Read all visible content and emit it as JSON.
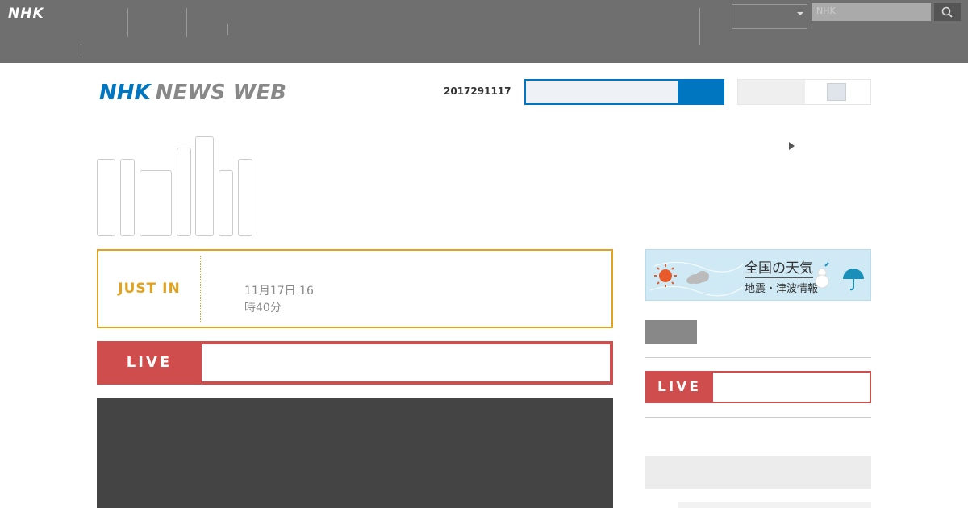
{
  "topbar": {
    "logo": "NHK",
    "nav": [
      {
        "l1": "",
        "l2": "",
        "l3": ""
      },
      {
        "l1": "",
        "l2": "",
        "l3": ""
      },
      {
        "l1": "",
        "l2": "",
        "l3": ""
      },
      {
        "l1": "",
        "l2": "",
        "l3": ""
      },
      {
        "l1": "",
        "l2": "",
        "l3": ""
      },
      {
        "l1": "",
        "l2": "",
        "l3": ""
      }
    ],
    "right_nav": [
      {
        "l1": "",
        "l2": "",
        "l3": ""
      },
      {
        "l1": "",
        "l2": "",
        "l3": ""
      }
    ],
    "select_value": "",
    "search_placeholder": "NHK",
    "search_icon": "search-icon"
  },
  "header": {
    "brand_nhk": "NHK",
    "brand_news": "NEWS WEB",
    "date": "2017291117",
    "toggle_label": ""
  },
  "categories": {
    "active_lines": [
      "",
      "",
      "",
      " "
    ]
  },
  "side_link": "",
  "just_in": {
    "label": "JUST IN",
    "title": "",
    "subtitle": "",
    "time_line1": "11月17日 16",
    "time_line2": "時40分"
  },
  "live_main": {
    "label": "LIVE",
    "text": " "
  },
  "sidebar": {
    "weather_title": "全国の天気",
    "weather_sub": "地震・津波情報",
    "link": "",
    "live_label": "LIVE",
    "live_text": " ",
    "section_head": ""
  },
  "colors": {
    "brand_blue": "#0076c0",
    "just_in_orange": "#e3a21e",
    "live_red": "#cf4d4d"
  }
}
